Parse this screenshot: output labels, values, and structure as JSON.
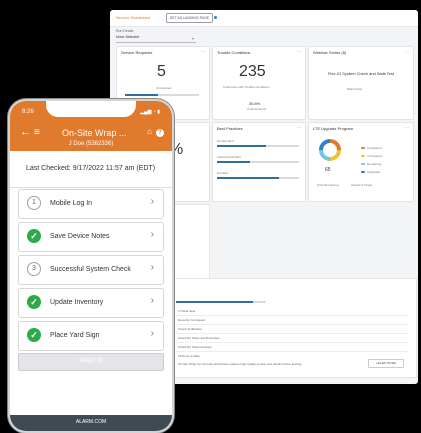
{
  "dashboard": {
    "breadcrumb": "Service Dashboard",
    "breadcrumb_button": "SET AS LANDING PAGE",
    "service_label": "Run Dealer",
    "service_value": "None Selected",
    "cards": {
      "service_requests": {
        "title": "Service Requests",
        "value": "5",
        "sublabel": "Unresolved",
        "foot": "1/3",
        "foot_label": "Completed"
      },
      "trouble_conditions": {
        "title": "Trouble Conditions",
        "value": "235",
        "sub": "Customers with Trouble Conditions",
        "stat": "35.8%",
        "stat_label": "of all accounts"
      },
      "webinar": {
        "title": "Webinar Series (6)",
        "headline": "Flex-IO System Check and Walk Test",
        "sub": "Watch Now"
      },
      "best_practices": {
        "title": "Best Practices",
        "rows": [
          "Not Enrolled",
          "Advanced Default",
          "Enrolled"
        ]
      },
      "lte": {
        "title": "LTE Upgrade Program",
        "value": "65",
        "a": "Total Remaining",
        "b": "Ahead of Target",
        "legend": [
          "Completed",
          "In Progress",
          "Remaining",
          "Upgraded"
        ]
      }
    },
    "percent": "%",
    "table": {
      "rows": [
        "4 Ticket Sets",
        "Recently Completed",
        "Check Verification",
        "Check By Ticket and Reviewed",
        "Check By Ticket at Reset",
        "All Done to Date"
      ],
      "note": "On-Site Wrap Up can help technicians capture high-quality service visit details before leaving.",
      "learn": "LEARN MORE"
    }
  },
  "phone": {
    "time": "8:26",
    "title": "On-Site Wrap ...",
    "subtitle": "J Doe (5362336)",
    "last_checked": "Last Checked: 9/17/2022 11:57 am (EDT)",
    "items": [
      {
        "label": "Mobile Log In",
        "state": "1"
      },
      {
        "label": "Save Device Notes",
        "state": "check"
      },
      {
        "label": "Successful System Check",
        "state": "3"
      },
      {
        "label": "Update Inventory",
        "state": "check"
      },
      {
        "label": "Place Yard Sign",
        "state": "check"
      }
    ],
    "finish": "Wrap Up",
    "brand": "ALARM.COM"
  }
}
